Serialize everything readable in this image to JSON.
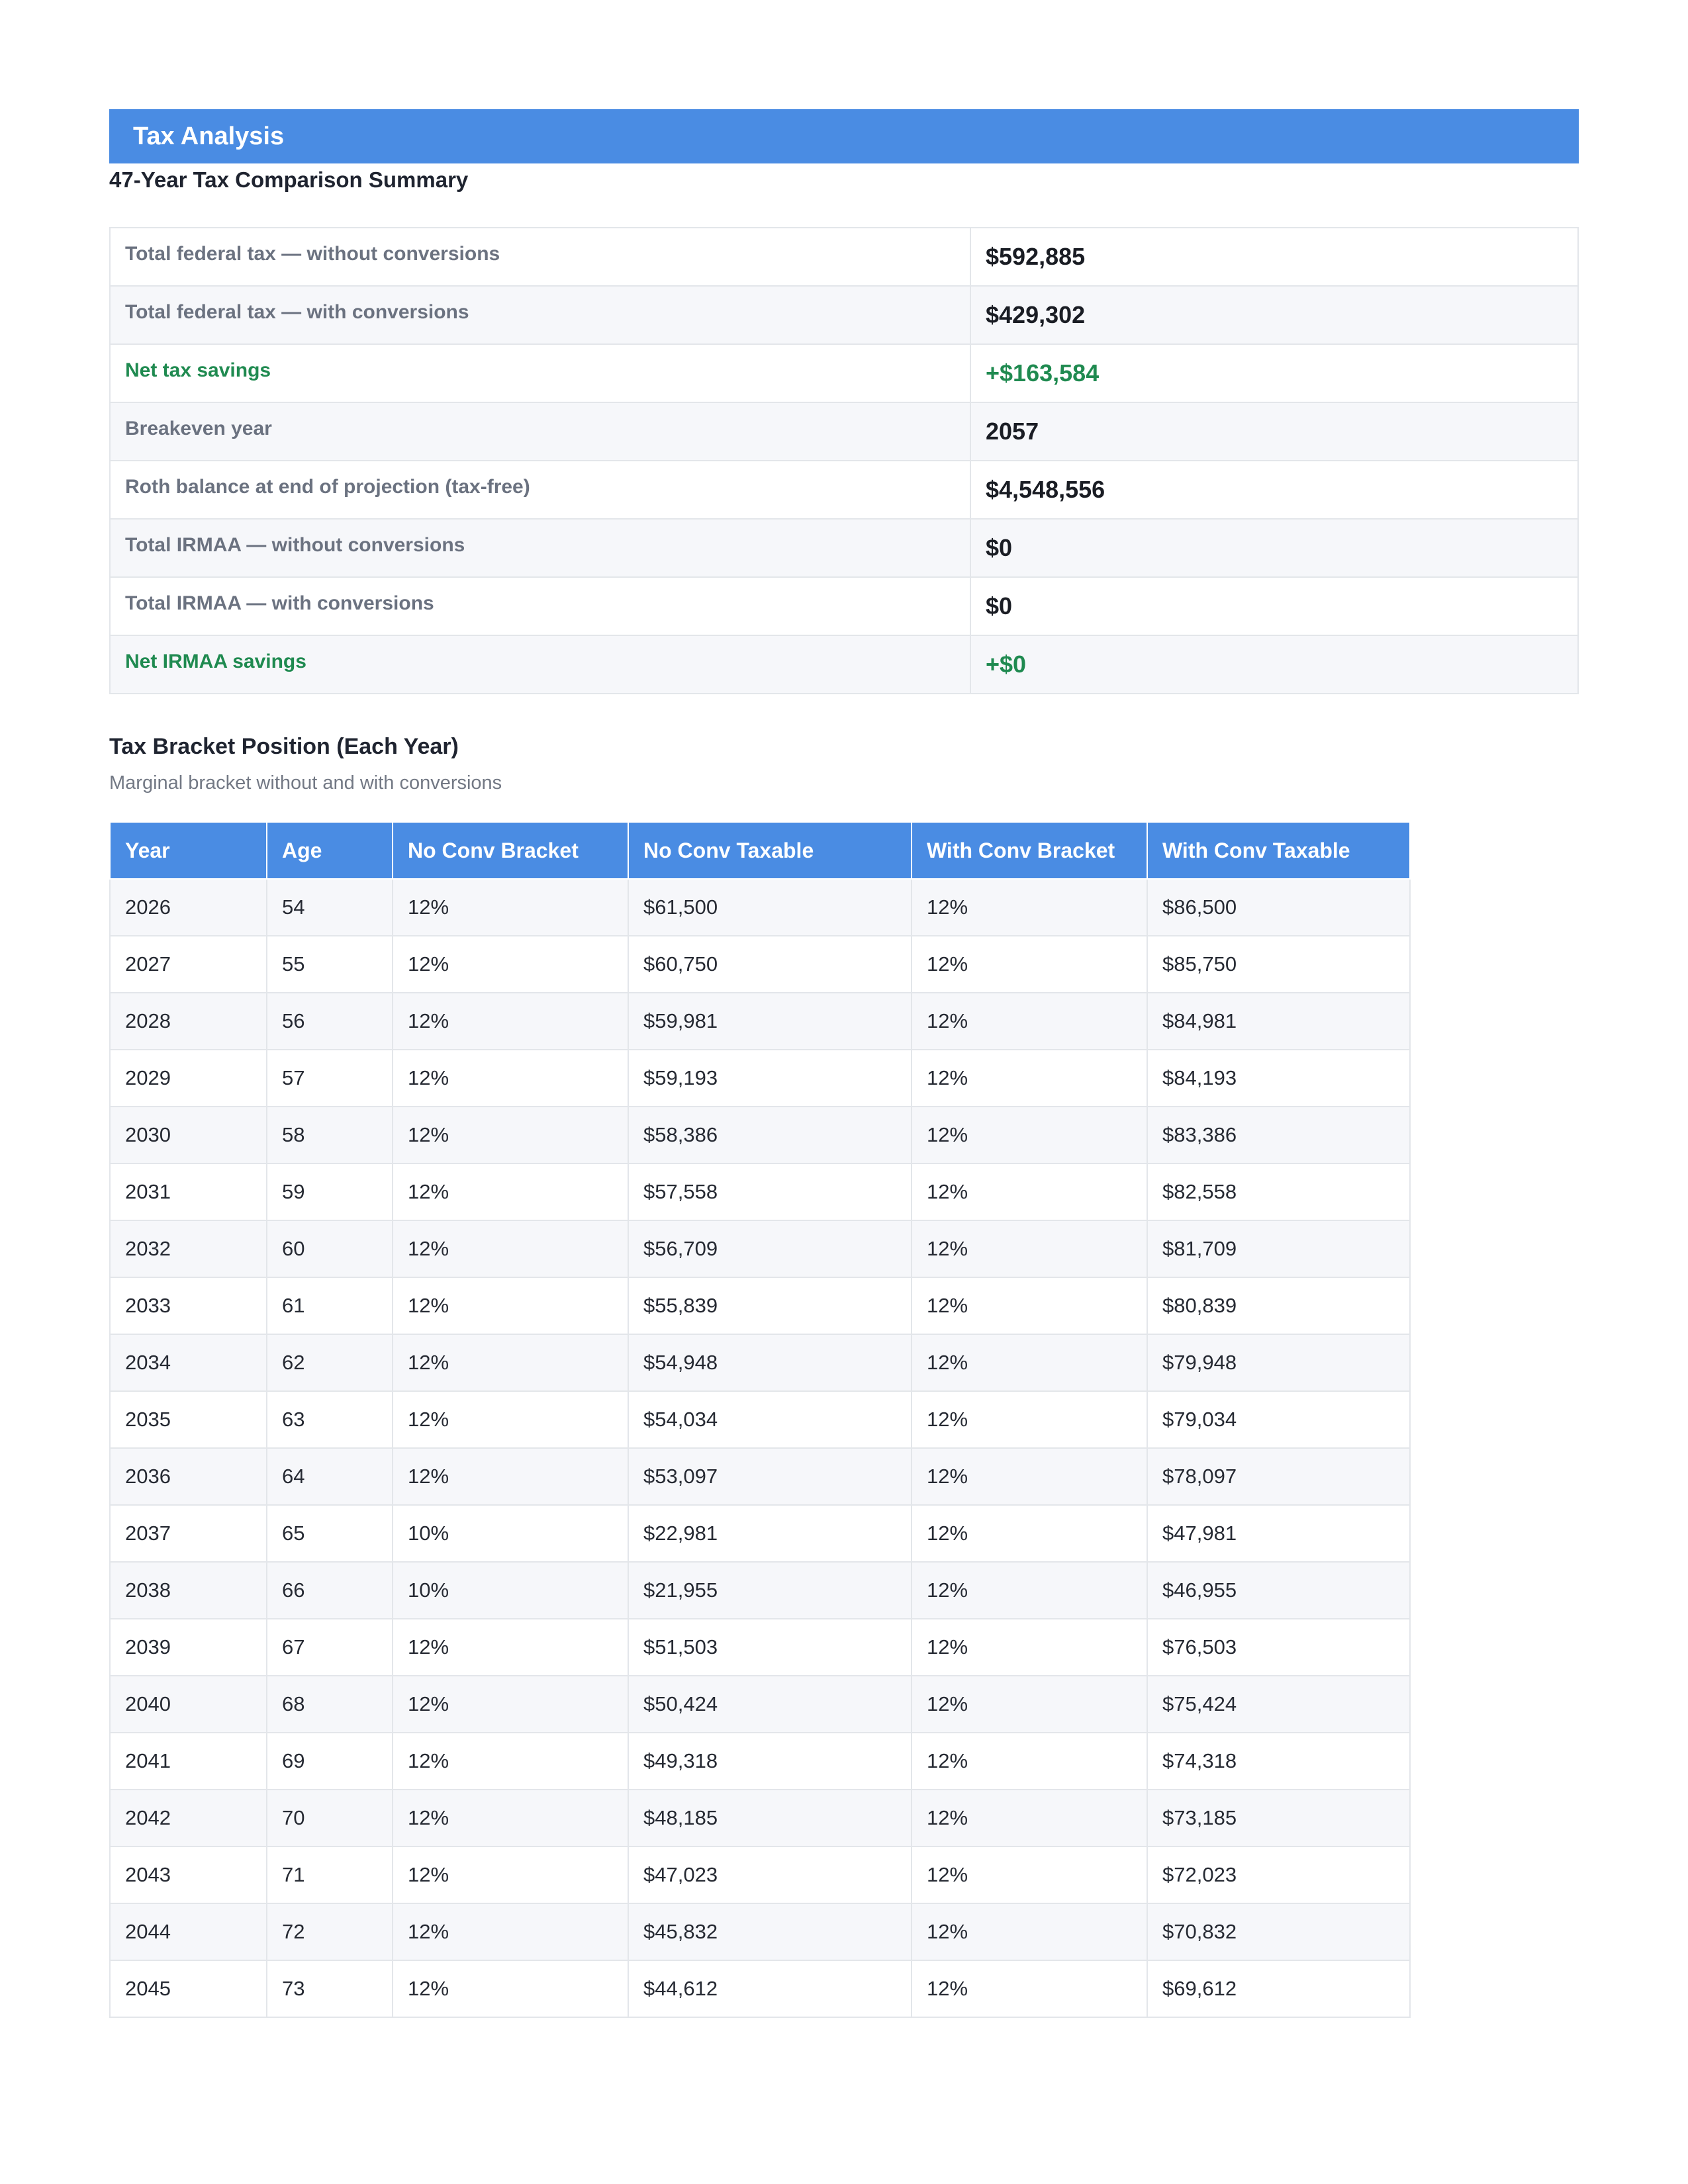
{
  "header": {
    "banner_title": "Tax Analysis",
    "summary_title": "47-Year Tax Comparison Summary"
  },
  "summary_rows": [
    {
      "label": "Total federal tax — without conversions",
      "value": "$592,885",
      "highlight": false
    },
    {
      "label": "Total federal tax — with conversions",
      "value": "$429,302",
      "highlight": false
    },
    {
      "label": "Net tax savings",
      "value": "+$163,584",
      "highlight": true
    },
    {
      "label": "Breakeven year",
      "value": "2057",
      "highlight": false
    },
    {
      "label": "Roth balance at end of projection (tax-free)",
      "value": "$4,548,556",
      "highlight": false
    },
    {
      "label": "Total IRMAA — without conversions",
      "value": "$0",
      "highlight": false
    },
    {
      "label": "Total IRMAA — with conversions",
      "value": "$0",
      "highlight": false
    },
    {
      "label": "Net IRMAA savings",
      "value": "+$0",
      "highlight": true
    }
  ],
  "bracket_section": {
    "title": "Tax Bracket Position (Each Year)",
    "subtitle": "Marginal bracket without and with conversions",
    "columns": [
      "Year",
      "Age",
      "No Conv Bracket",
      "No Conv Taxable",
      "With Conv Bracket",
      "With Conv Taxable"
    ],
    "rows": [
      [
        "2026",
        "54",
        "12%",
        "$61,500",
        "12%",
        "$86,500"
      ],
      [
        "2027",
        "55",
        "12%",
        "$60,750",
        "12%",
        "$85,750"
      ],
      [
        "2028",
        "56",
        "12%",
        "$59,981",
        "12%",
        "$84,981"
      ],
      [
        "2029",
        "57",
        "12%",
        "$59,193",
        "12%",
        "$84,193"
      ],
      [
        "2030",
        "58",
        "12%",
        "$58,386",
        "12%",
        "$83,386"
      ],
      [
        "2031",
        "59",
        "12%",
        "$57,558",
        "12%",
        "$82,558"
      ],
      [
        "2032",
        "60",
        "12%",
        "$56,709",
        "12%",
        "$81,709"
      ],
      [
        "2033",
        "61",
        "12%",
        "$55,839",
        "12%",
        "$80,839"
      ],
      [
        "2034",
        "62",
        "12%",
        "$54,948",
        "12%",
        "$79,948"
      ],
      [
        "2035",
        "63",
        "12%",
        "$54,034",
        "12%",
        "$79,034"
      ],
      [
        "2036",
        "64",
        "12%",
        "$53,097",
        "12%",
        "$78,097"
      ],
      [
        "2037",
        "65",
        "10%",
        "$22,981",
        "12%",
        "$47,981"
      ],
      [
        "2038",
        "66",
        "10%",
        "$21,955",
        "12%",
        "$46,955"
      ],
      [
        "2039",
        "67",
        "12%",
        "$51,503",
        "12%",
        "$76,503"
      ],
      [
        "2040",
        "68",
        "12%",
        "$50,424",
        "12%",
        "$75,424"
      ],
      [
        "2041",
        "69",
        "12%",
        "$49,318",
        "12%",
        "$74,318"
      ],
      [
        "2042",
        "70",
        "12%",
        "$48,185",
        "12%",
        "$73,185"
      ],
      [
        "2043",
        "71",
        "12%",
        "$47,023",
        "12%",
        "$72,023"
      ],
      [
        "2044",
        "72",
        "12%",
        "$45,832",
        "12%",
        "$70,832"
      ],
      [
        "2045",
        "73",
        "12%",
        "$44,612",
        "12%",
        "$69,612"
      ]
    ]
  },
  "colors": {
    "accent": "#4a8ce3",
    "positive": "#1f8a50",
    "label_gray": "#6b7280"
  }
}
